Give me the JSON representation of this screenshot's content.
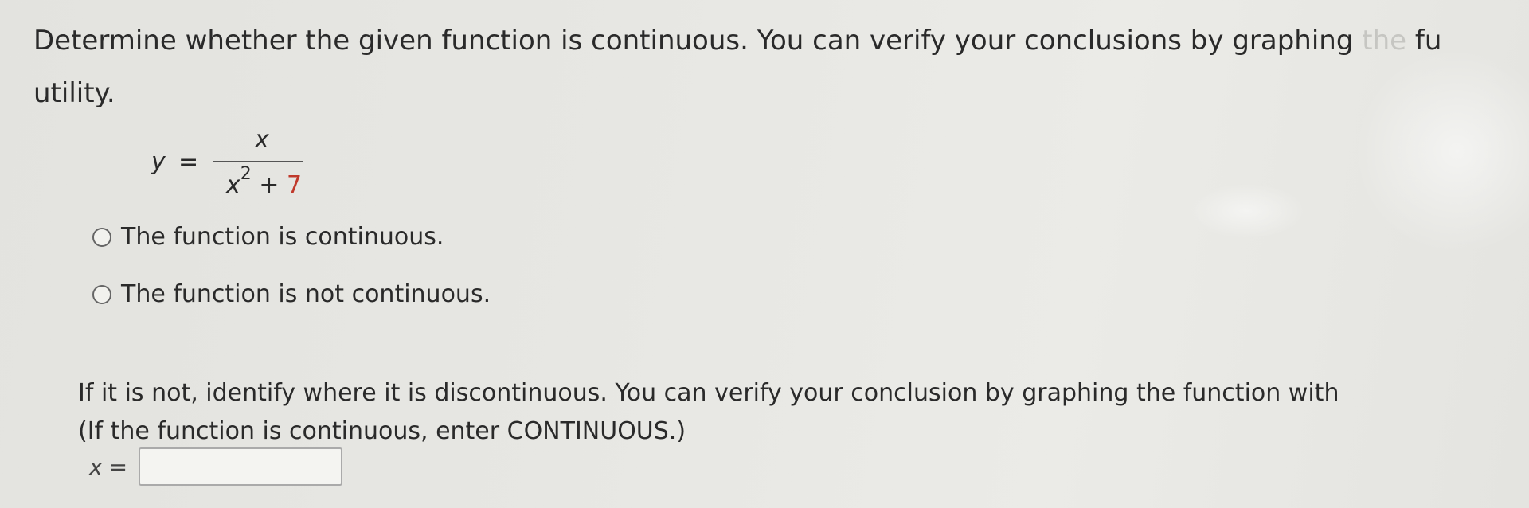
{
  "question": {
    "line1_main": "Determine whether the given function is continuous. You can verify your conclusions by graphing ",
    "line1_faded": "the",
    "line1_end": " fu",
    "line2": "utility."
  },
  "equation": {
    "lhs": "y",
    "equals": "=",
    "numerator": "x",
    "denominator_var": "x",
    "denominator_exp": "2",
    "denominator_plus": " + ",
    "denominator_const": "7"
  },
  "options": [
    {
      "label": "The function is continuous.",
      "selected": false
    },
    {
      "label": "The function is not continuous.",
      "selected": false
    }
  ],
  "followup": {
    "line1": "If it is not, identify where it is discontinuous. You can verify your conclusion by graphing the function with",
    "line2": "(If the function is continuous, enter CONTINUOUS.)"
  },
  "answer": {
    "var": "x",
    "equals": "=",
    "value": ""
  }
}
